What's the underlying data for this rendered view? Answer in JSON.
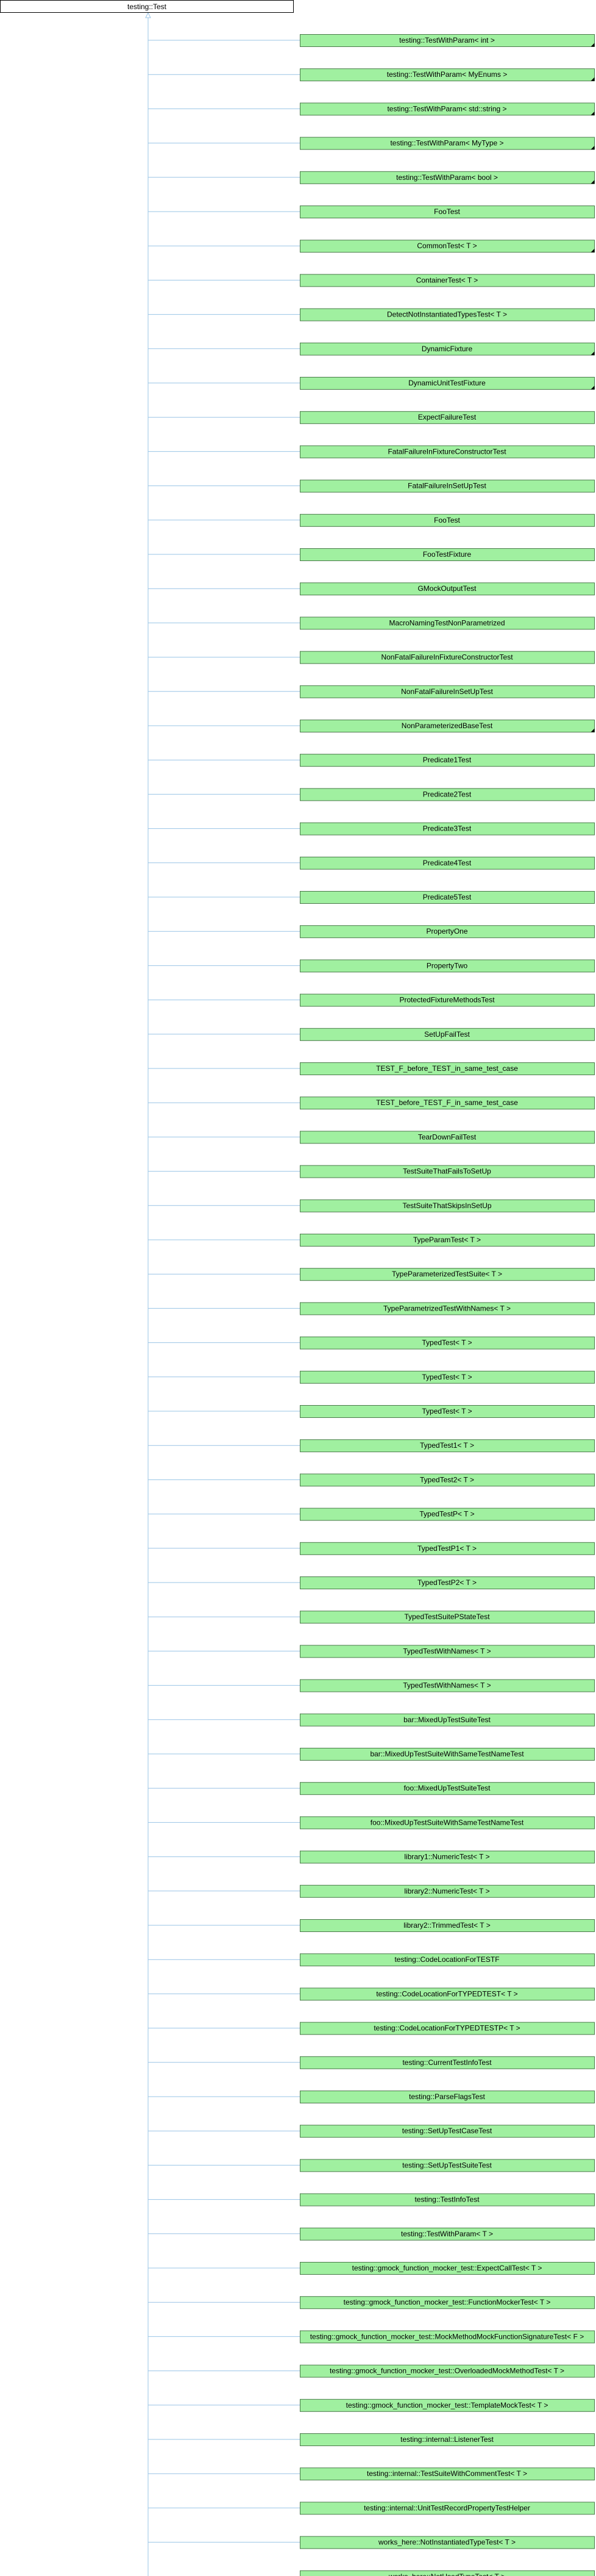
{
  "root": {
    "label": "testing::Test"
  },
  "colors": {
    "node_fill": "#a0f0a0",
    "node_border": "#4a7a4a",
    "root_fill": "#ffffff",
    "root_border": "#000000",
    "edge": "#9ac4e6"
  },
  "children": [
    {
      "label": "testing::TestWithParam< int >",
      "folded": true
    },
    {
      "label": "testing::TestWithParam< MyEnums >",
      "folded": true
    },
    {
      "label": "testing::TestWithParam< std::string >",
      "folded": true
    },
    {
      "label": "testing::TestWithParam< MyType >",
      "folded": true
    },
    {
      "label": "testing::TestWithParam< bool >",
      "folded": true
    },
    {
      "label": "FooTest",
      "folded": false
    },
    {
      "label": "CommonTest< T >",
      "folded": true
    },
    {
      "label": "ContainerTest< T >",
      "folded": false
    },
    {
      "label": "DetectNotInstantiatedTypesTest< T >",
      "folded": false
    },
    {
      "label": "DynamicFixture",
      "folded": true
    },
    {
      "label": "DynamicUnitTestFixture",
      "folded": true
    },
    {
      "label": "ExpectFailureTest",
      "folded": false
    },
    {
      "label": "FatalFailureInFixtureConstructorTest",
      "folded": false
    },
    {
      "label": "FatalFailureInSetUpTest",
      "folded": false
    },
    {
      "label": "FooTest",
      "folded": false
    },
    {
      "label": "FooTestFixture",
      "folded": false
    },
    {
      "label": "GMockOutputTest",
      "folded": false
    },
    {
      "label": "MacroNamingTestNonParametrized",
      "folded": false
    },
    {
      "label": "NonFatalFailureInFixtureConstructorTest",
      "folded": false
    },
    {
      "label": "NonFatalFailureInSetUpTest",
      "folded": false
    },
    {
      "label": "NonParameterizedBaseTest",
      "folded": true
    },
    {
      "label": "Predicate1Test",
      "folded": false
    },
    {
      "label": "Predicate2Test",
      "folded": false
    },
    {
      "label": "Predicate3Test",
      "folded": false
    },
    {
      "label": "Predicate4Test",
      "folded": false
    },
    {
      "label": "Predicate5Test",
      "folded": false
    },
    {
      "label": "PropertyOne",
      "folded": false
    },
    {
      "label": "PropertyTwo",
      "folded": false
    },
    {
      "label": "ProtectedFixtureMethodsTest",
      "folded": false
    },
    {
      "label": "SetUpFailTest",
      "folded": false
    },
    {
      "label": "TEST_F_before_TEST_in_same_test_case",
      "folded": false
    },
    {
      "label": "TEST_before_TEST_F_in_same_test_case",
      "folded": false
    },
    {
      "label": "TearDownFailTest",
      "folded": false
    },
    {
      "label": "TestSuiteThatFailsToSetUp",
      "folded": false
    },
    {
      "label": "TestSuiteThatSkipsInSetUp",
      "folded": false
    },
    {
      "label": "TypeParamTest< T >",
      "folded": false
    },
    {
      "label": "TypeParameterizedTestSuite< T >",
      "folded": false
    },
    {
      "label": "TypeParametrizedTestWithNames< T >",
      "folded": false
    },
    {
      "label": "TypedTest< T >",
      "folded": false
    },
    {
      "label": "TypedTest< T >",
      "folded": false
    },
    {
      "label": "TypedTest< T >",
      "folded": false
    },
    {
      "label": "TypedTest1< T >",
      "folded": false
    },
    {
      "label": "TypedTest2< T >",
      "folded": false
    },
    {
      "label": "TypedTestP< T >",
      "folded": false
    },
    {
      "label": "TypedTestP1< T >",
      "folded": false
    },
    {
      "label": "TypedTestP2< T >",
      "folded": false
    },
    {
      "label": "TypedTestSuitePStateTest",
      "folded": false
    },
    {
      "label": "TypedTestWithNames< T >",
      "folded": false
    },
    {
      "label": "TypedTestWithNames< T >",
      "folded": false
    },
    {
      "label": "bar::MixedUpTestSuiteTest",
      "folded": false
    },
    {
      "label": "bar::MixedUpTestSuiteWithSameTestNameTest",
      "folded": false
    },
    {
      "label": "foo::MixedUpTestSuiteTest",
      "folded": false
    },
    {
      "label": "foo::MixedUpTestSuiteWithSameTestNameTest",
      "folded": false
    },
    {
      "label": "library1::NumericTest< T >",
      "folded": false
    },
    {
      "label": "library2::NumericTest< T >",
      "folded": false
    },
    {
      "label": "library2::TrimmedTest< T >",
      "folded": false
    },
    {
      "label": "testing::CodeLocationForTESTF",
      "folded": false
    },
    {
      "label": "testing::CodeLocationForTYPEDTEST< T >",
      "folded": false
    },
    {
      "label": "testing::CodeLocationForTYPEDTESTP< T >",
      "folded": false
    },
    {
      "label": "testing::CurrentTestInfoTest",
      "folded": false
    },
    {
      "label": "testing::ParseFlagsTest",
      "folded": false
    },
    {
      "label": "testing::SetUpTestCaseTest",
      "folded": false
    },
    {
      "label": "testing::SetUpTestSuiteTest",
      "folded": false
    },
    {
      "label": "testing::TestInfoTest",
      "folded": false
    },
    {
      "label": "testing::TestWithParam< T >",
      "folded": false
    },
    {
      "label": "testing::gmock_function_mocker_test::ExpectCallTest< T >",
      "folded": false
    },
    {
      "label": "testing::gmock_function_mocker_test::FunctionMockerTest< T >",
      "folded": false
    },
    {
      "label": "testing::gmock_function_mocker_test::MockMethodMockFunctionSignatureTest< F >",
      "folded": false
    },
    {
      "label": "testing::gmock_function_mocker_test::OverloadedMockMethodTest< T >",
      "folded": false
    },
    {
      "label": "testing::gmock_function_mocker_test::TemplateMockTest< T >",
      "folded": false
    },
    {
      "label": "testing::internal::ListenerTest",
      "folded": false
    },
    {
      "label": "testing::internal::TestSuiteWithCommentTest< T >",
      "folded": false
    },
    {
      "label": "testing::internal::UnitTestRecordPropertyTestHelper",
      "folded": false
    },
    {
      "label": "works_here::NotInstantiatedTypeTest< T >",
      "folded": false
    },
    {
      "label": "works_here::NotUsedTypeTest< T >",
      "folded": false
    }
  ]
}
